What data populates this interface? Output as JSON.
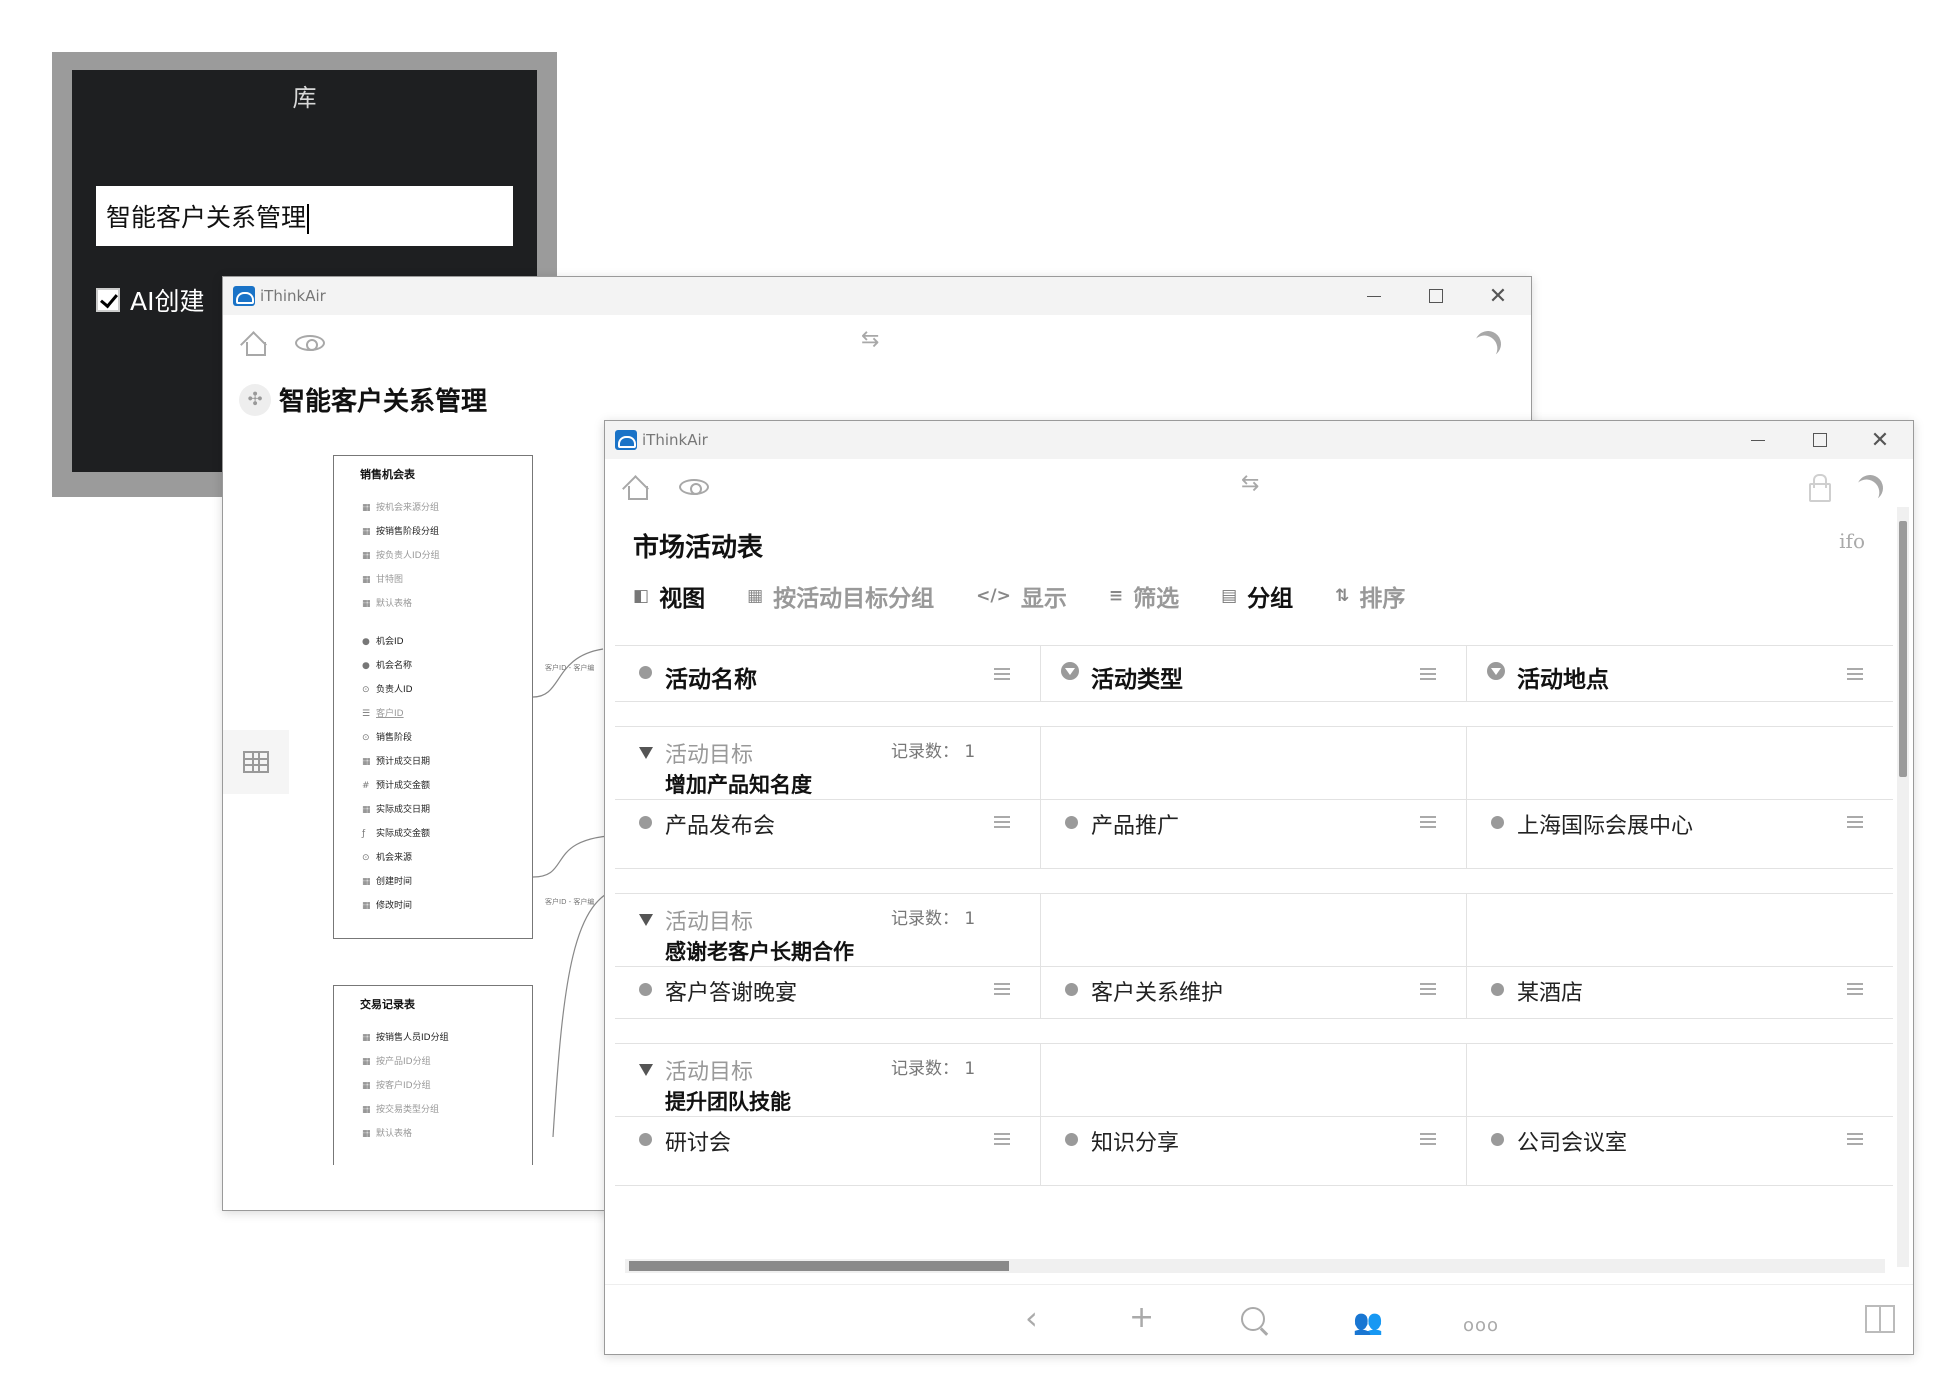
{
  "dialog": {
    "title": "库",
    "input_value": "智能客户关系管理",
    "ai_create_label": "AI创建"
  },
  "app": {
    "name": "iThinkAir"
  },
  "window1": {
    "title": "智能客户关系管理",
    "cards": [
      {
        "title": "销售机会表",
        "views": [
          "按机会来源分组",
          "按销售阶段分组",
          "按负责人ID分组",
          "甘特图",
          "默认表格"
        ],
        "fields": [
          {
            "icon": "●",
            "label": "机会ID"
          },
          {
            "icon": "●",
            "label": "机会名称"
          },
          {
            "icon": "⊙",
            "label": "负责人ID"
          },
          {
            "icon": "☰",
            "label": "客户ID"
          },
          {
            "icon": "⊙",
            "label": "销售阶段"
          },
          {
            "icon": "▦",
            "label": "预计成交日期"
          },
          {
            "icon": "#",
            "label": "预计成交金额"
          },
          {
            "icon": "▦",
            "label": "实际成交日期"
          },
          {
            "icon": "ƒ",
            "label": "实际成交金额"
          },
          {
            "icon": "⊙",
            "label": "机会来源"
          },
          {
            "icon": "▦",
            "label": "创建时间"
          },
          {
            "icon": "▦",
            "label": "修改时间"
          }
        ]
      },
      {
        "title": "交易记录表",
        "views": [
          "按销售人员ID分组",
          "按产品ID分组",
          "按客户ID分组",
          "按交易类型分组",
          "默认表格"
        ]
      }
    ],
    "edge_labels": [
      "客户ID - 客户编",
      "客户ID - 客户编"
    ]
  },
  "window2": {
    "title": "市场活动表",
    "info": "ifo",
    "viewbar": [
      {
        "icon": "◧",
        "label": "视图",
        "active": true
      },
      {
        "icon": "▦",
        "label": "按活动目标分组",
        "active": false
      },
      {
        "icon": "</>",
        "label": "显示",
        "active": false
      },
      {
        "icon": "≡",
        "label": "筛选",
        "active": false
      },
      {
        "icon": "▤",
        "label": "分组",
        "active": true
      },
      {
        "icon": "⇅",
        "label": "排序",
        "active": false
      }
    ],
    "columns": [
      "活动名称",
      "活动类型",
      "活动地点"
    ],
    "group_field": "活动目标",
    "count_label": "记录数：",
    "groups": [
      {
        "value": "增加产品知名度",
        "count": "1",
        "rows": [
          [
            "产品发布会",
            "产品推广",
            "上海国际会展中心"
          ]
        ]
      },
      {
        "value": "感谢老客户长期合作",
        "count": "1",
        "rows": [
          [
            "客户答谢晚宴",
            "客户关系维护",
            "某酒店"
          ]
        ]
      },
      {
        "value": "提升团队技能",
        "count": "1",
        "rows": [
          [
            "研讨会",
            "知识分享",
            "公司会议室"
          ]
        ]
      }
    ]
  }
}
